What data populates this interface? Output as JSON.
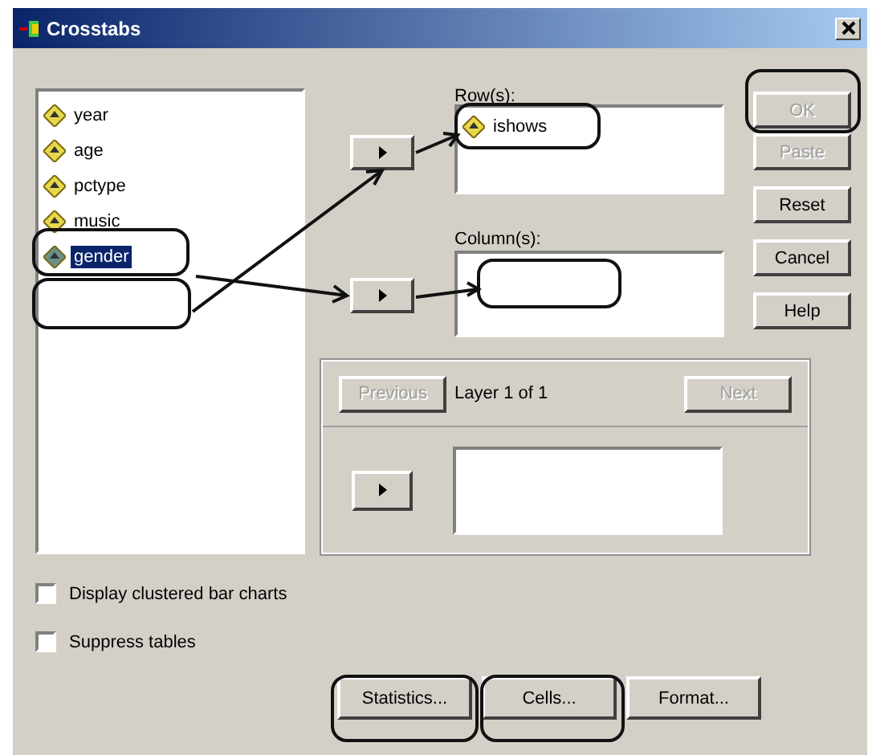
{
  "window": {
    "title": "Crosstabs"
  },
  "variables": [
    {
      "label": "year",
      "selected": false
    },
    {
      "label": "age",
      "selected": false
    },
    {
      "label": "pctype",
      "selected": false
    },
    {
      "label": "music",
      "selected": false
    },
    {
      "label": "gender",
      "selected": true
    }
  ],
  "rows": {
    "label": "Row(s):",
    "items": [
      "ishows"
    ]
  },
  "columns": {
    "label": "Column(s):"
  },
  "buttons": [
    {
      "label": "OK",
      "disabled": true
    },
    {
      "label": "Paste",
      "disabled": true
    },
    {
      "label": "Reset",
      "disabled": false
    },
    {
      "label": "Cancel",
      "disabled": false
    },
    {
      "label": "Help",
      "disabled": false
    }
  ],
  "layer": {
    "previous": {
      "label": "Previous",
      "disabled": true
    },
    "text": "Layer 1 of 1",
    "next": {
      "label": "Next",
      "disabled": true
    }
  },
  "checkboxes": [
    {
      "label": "Display clustered bar charts",
      "checked": false
    },
    {
      "label": "Suppress tables",
      "checked": false
    }
  ],
  "bottom_buttons": [
    "Statistics...",
    "Cells...",
    "Format..."
  ]
}
